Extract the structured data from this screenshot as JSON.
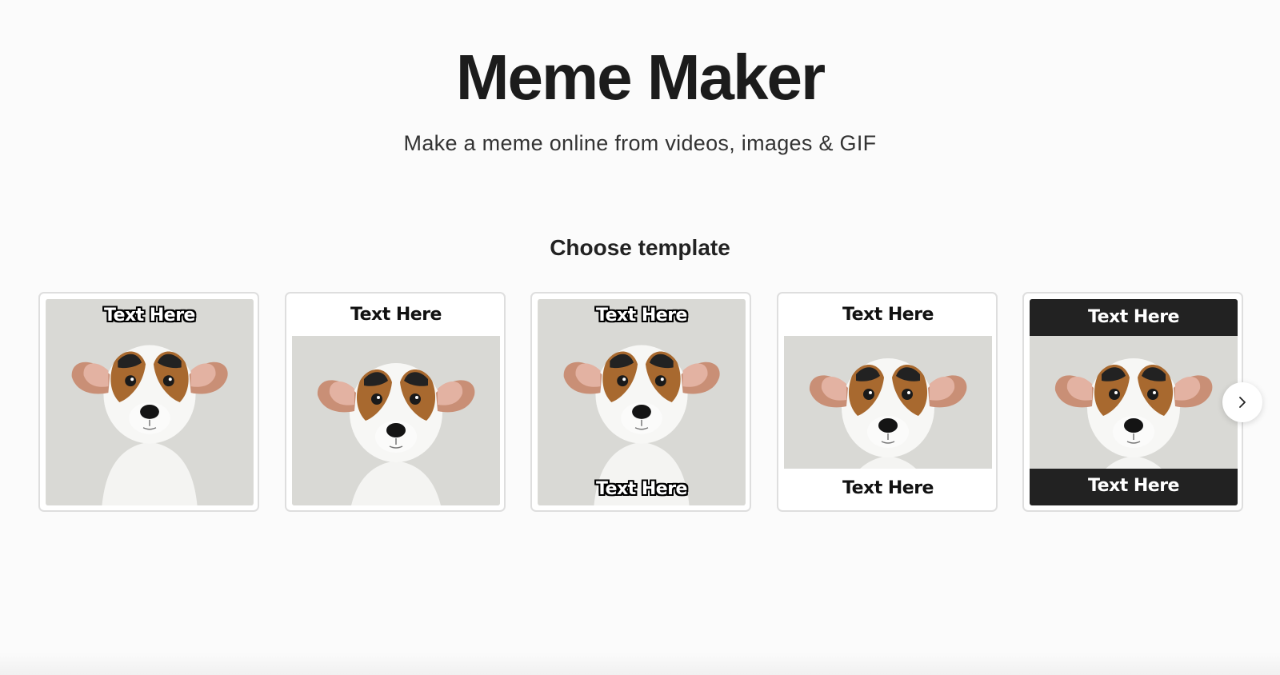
{
  "header": {
    "title": "Meme Maker",
    "subtitle": "Make a meme online from videos, images & GIF"
  },
  "templates": {
    "heading": "Choose template",
    "items": [
      {
        "style": "top-outline",
        "top_text": "Text Here"
      },
      {
        "style": "top-white-bar",
        "top_text": "Text Here"
      },
      {
        "style": "top-bottom-outline",
        "top_text": "Text Here",
        "bottom_text": "Text Here"
      },
      {
        "style": "top-bottom-white-bars",
        "top_text": "Text Here",
        "bottom_text": "Text Here"
      },
      {
        "style": "top-bottom-black-bars",
        "top_text": "Text Here",
        "bottom_text": "Text Here"
      }
    ],
    "next_icon": "chevron-right-icon"
  },
  "colors": {
    "background": "#fbfbfb",
    "bar_dark": "#222222",
    "card_border": "#dedede"
  }
}
